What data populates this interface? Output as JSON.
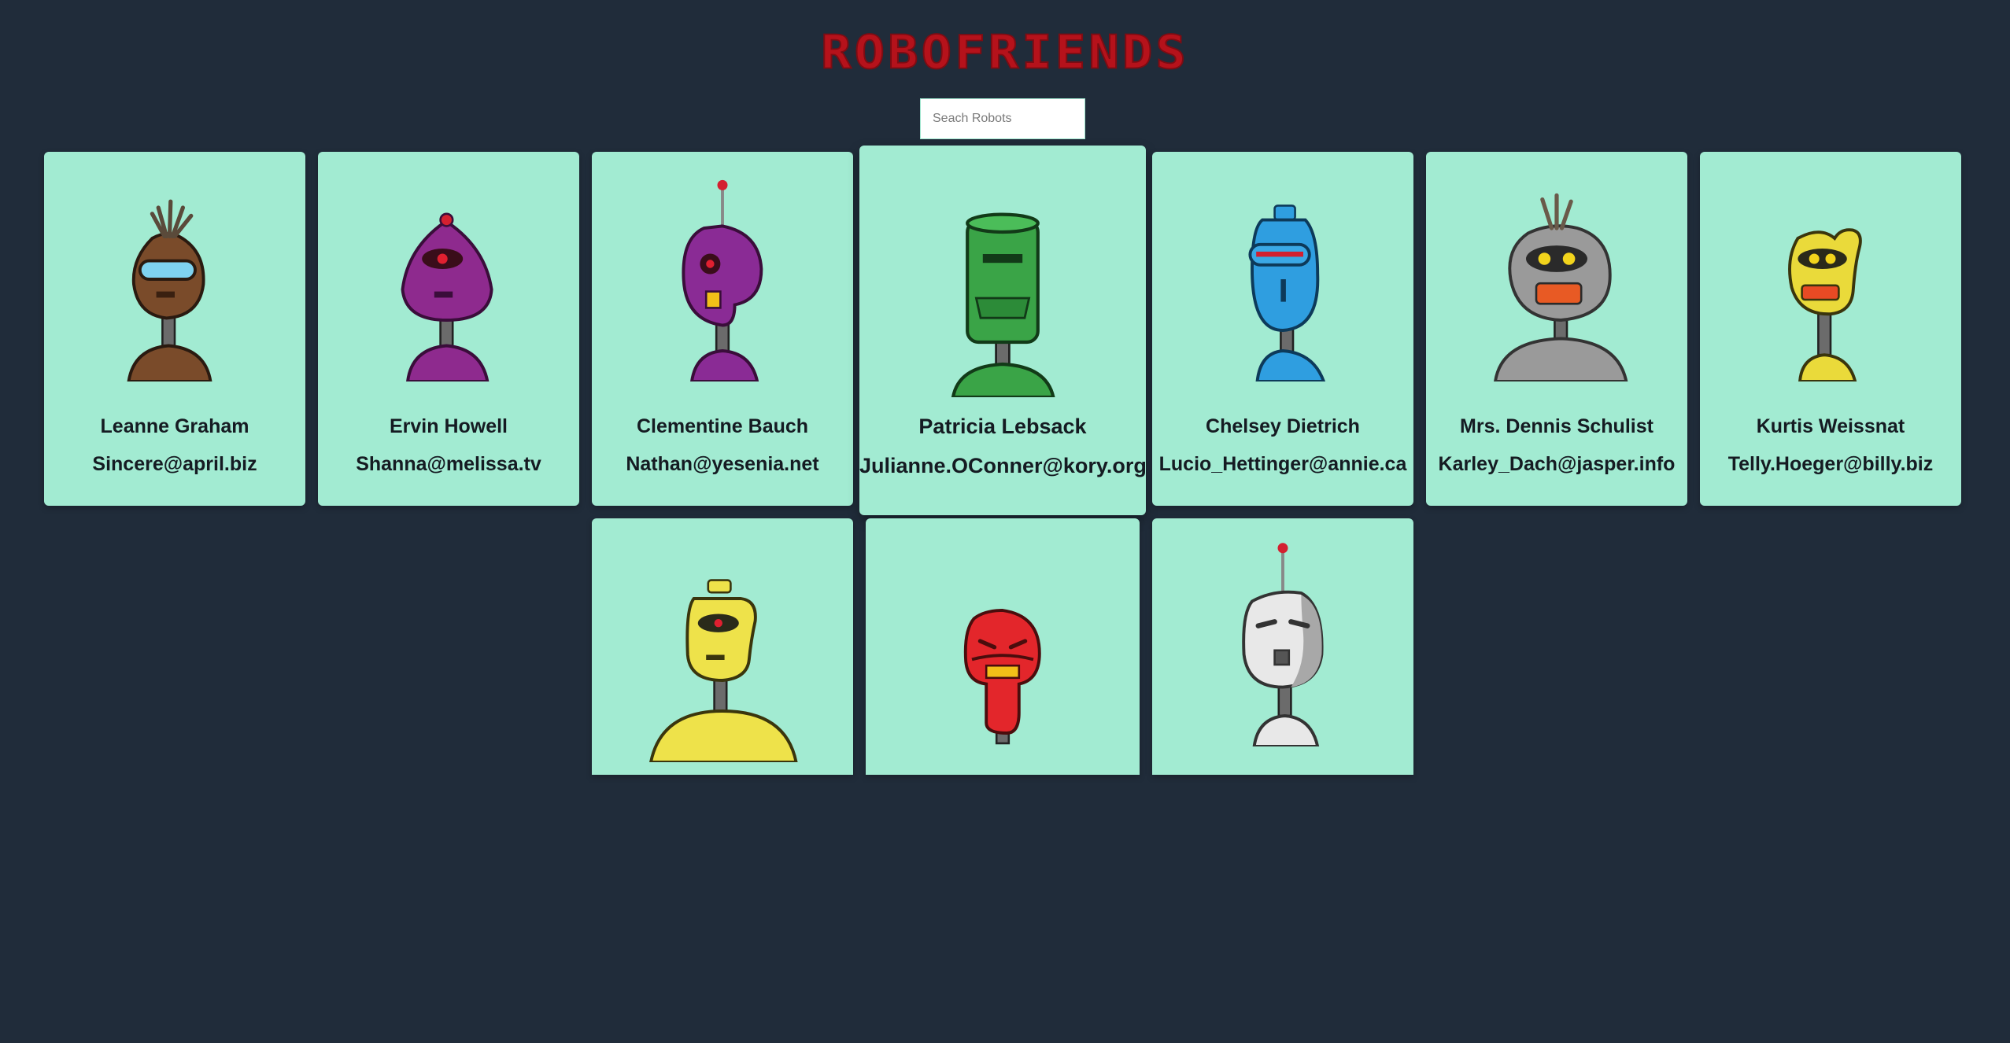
{
  "app": {
    "title": "ROBOFRIENDS"
  },
  "search": {
    "placeholder": "Seach Robots",
    "value": ""
  },
  "robots": [
    {
      "name": "Leanne Graham",
      "email": "Sincere@april.biz",
      "color": "#7a4b2a",
      "icon": "robot-brown-icon"
    },
    {
      "name": "Ervin Howell",
      "email": "Shanna@melissa.tv",
      "color": "#8e2a8e",
      "icon": "robot-purple-icon"
    },
    {
      "name": "Clementine Bauch",
      "email": "Nathan@yesenia.net",
      "color": "#8a2b95",
      "icon": "robot-purple-antenna-icon"
    },
    {
      "name": "Patricia Lebsack",
      "email": "Julianne.OConner@kory.org",
      "color": "#3aa447",
      "icon": "robot-green-icon"
    },
    {
      "name": "Chelsey Dietrich",
      "email": "Lucio_Hettinger@annie.ca",
      "color": "#2f9ee0",
      "icon": "robot-blue-icon"
    },
    {
      "name": "Mrs. Dennis Schulist",
      "email": "Karley_Dach@jasper.info",
      "color": "#9a9a9a",
      "icon": "robot-gray-icon"
    },
    {
      "name": "Kurtis Weissnat",
      "email": "Telly.Hoeger@billy.biz",
      "color": "#eada3a",
      "icon": "robot-yellow-icon"
    },
    {
      "name": "",
      "email": "",
      "color": "#eee24a",
      "icon": "robot-yellow-round-icon"
    },
    {
      "name": "",
      "email": "",
      "color": "#e3262b",
      "icon": "robot-red-icon"
    },
    {
      "name": "",
      "email": "",
      "color": "#e8e8e8",
      "icon": "robot-white-icon"
    }
  ]
}
